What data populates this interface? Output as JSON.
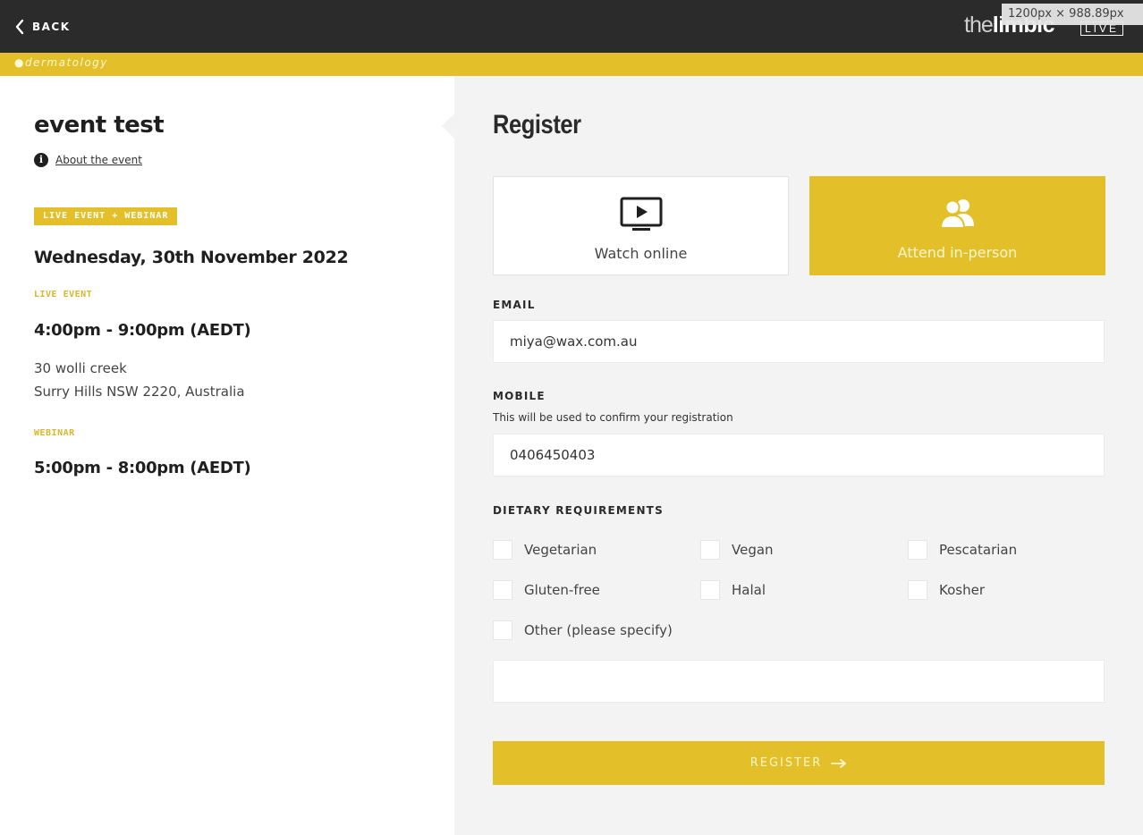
{
  "topbar": {
    "back_label": "BACK",
    "logo_the": "the",
    "logo_limbic": "limbic",
    "logo_live": "LIVE",
    "dimensions_badge": "1200px × 988.89px"
  },
  "strip": {
    "label": "●dermatology"
  },
  "event": {
    "title": "event test",
    "about_link": "About the event",
    "tag": "LIVE EVENT + WEBINAR",
    "date": "Wednesday, 30th November 2022",
    "live_label": "LIVE EVENT",
    "live_time": "4:00pm - 9:00pm (AEDT)",
    "address_line1": "30 wolli creek",
    "address_line2": "Surry Hills NSW 2220, Australia",
    "webinar_label": "WEBINAR",
    "webinar_time": "5:00pm - 8:00pm (AEDT)"
  },
  "register": {
    "title": "Register",
    "modes": [
      {
        "label": "Watch online",
        "icon": "monitor-play-icon",
        "selected": false
      },
      {
        "label": "Attend in-person",
        "icon": "users-icon",
        "selected": true
      }
    ],
    "email_label": "EMAIL",
    "email_value": "miya@wax.com.au",
    "mobile_label": "MOBILE",
    "mobile_help": "This will be used to confirm your registration",
    "mobile_value": "0406450403",
    "dietary_label": "DIETARY REQUIREMENTS",
    "dietary_options": [
      "Vegetarian",
      "Vegan",
      "Pescatarian",
      "Gluten-free",
      "Halal",
      "Kosher",
      "Other (please specify)"
    ],
    "other_value": "",
    "submit_label": "REGISTER"
  },
  "colors": {
    "accent": "#e3bf2a",
    "topbar": "#2b2b2b",
    "panel": "#f3f3f3"
  }
}
